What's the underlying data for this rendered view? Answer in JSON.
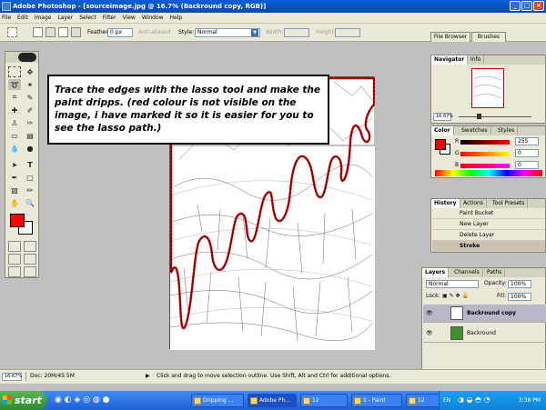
{
  "window": {
    "title": "Adobe Photoshop - [sourceimage.jpg @ 16.7% (Backround copy, RGB)]",
    "minimize_glyph": "_",
    "maximize_glyph": "□",
    "close_glyph": "×"
  },
  "menubar": {
    "items": [
      "File",
      "Edit",
      "Image",
      "Layer",
      "Select",
      "Filter",
      "View",
      "Window",
      "Help"
    ]
  },
  "options": {
    "feather_label": "Feather:",
    "feather_value": "0 px",
    "antialiased_label": "Anti-aliased",
    "style_label": "Style:",
    "style_value": "Normal",
    "width_label": "Width:",
    "height_label": "Height:",
    "file_browser_tab": "File Browser",
    "brushes_tab": "Brushes"
  },
  "callout": {
    "text": "Trace the edges with the lasso tool and make the paint dripps. (red colour is not visible on the image, i have marked it so it is easier  for you to see the lasso path.)"
  },
  "navigator": {
    "tabs": [
      "Navigator",
      "Info"
    ],
    "zoom": "16.67%"
  },
  "color_panel": {
    "tabs": [
      "Color",
      "Swatches",
      "Styles"
    ],
    "channels": [
      {
        "label": "R",
        "value": "255"
      },
      {
        "label": "G",
        "value": "0"
      },
      {
        "label": "B",
        "value": "0"
      }
    ],
    "foreground": "#ff0000"
  },
  "history": {
    "tabs": [
      "History",
      "Actions",
      "Tool Presets"
    ],
    "items": [
      "Paint Bucket",
      "New Layer",
      "Delete Layer",
      "Stroke"
    ]
  },
  "layers": {
    "tabs": [
      "Layers",
      "Channels",
      "Paths"
    ],
    "blend_mode": "Normal",
    "opacity_label": "Opacity:",
    "opacity_value": "100%",
    "lock_label": "Lock:",
    "fill_label": "Fill:",
    "fill_value": "100%",
    "items": [
      {
        "name": "Backround copy"
      },
      {
        "name": "Backround"
      }
    ]
  },
  "status": {
    "zoom": "16.67%",
    "doc": "Doc: 20M/45.5M",
    "hint": "Click and drag to move selection outline.  Use Shift, Alt and Ctrl for additional options."
  },
  "taskbar": {
    "start": "start",
    "tasks": [
      "Dripping ...",
      "Adobe Ph...",
      "12",
      "1 - Paint",
      "12"
    ],
    "lang": "EN",
    "clock": "3:38 PM"
  },
  "colors": {
    "lasso": "#cc0000",
    "title_blue": "#0a5fd8",
    "panel_bg": "#ece9d8"
  }
}
